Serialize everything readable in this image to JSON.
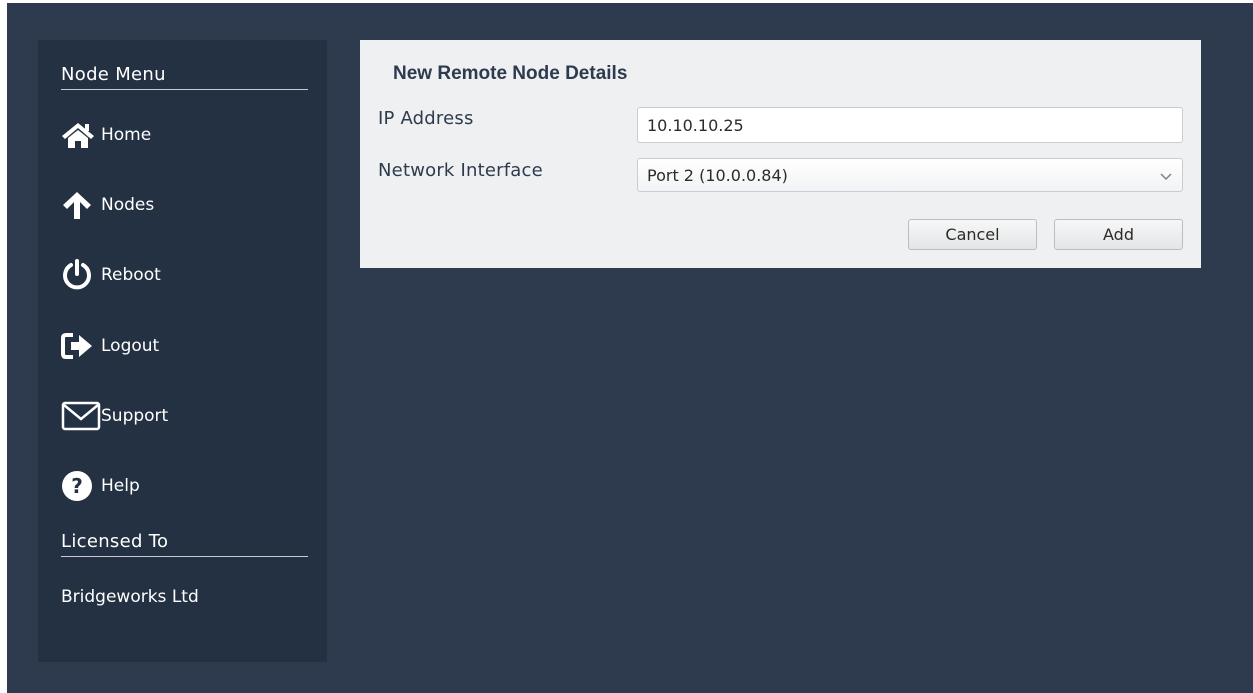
{
  "sidebar": {
    "node_menu_title": "Node Menu",
    "items": [
      {
        "label": "Home",
        "icon": "home-icon"
      },
      {
        "label": "Nodes",
        "icon": "arrow-up-icon"
      },
      {
        "label": "Reboot",
        "icon": "power-icon"
      },
      {
        "label": "Logout",
        "icon": "logout-icon"
      },
      {
        "label": "Support",
        "icon": "envelope-icon"
      },
      {
        "label": "Help",
        "icon": "question-icon"
      }
    ],
    "licensed_title": "Licensed To",
    "licensee": "Bridgeworks Ltd"
  },
  "panel": {
    "title": "New Remote Node Details",
    "ip_label": "IP Address",
    "ip_value": "10.10.10.25",
    "iface_label": "Network Interface",
    "iface_value": "Port 2 (10.0.0.84)",
    "cancel_label": "Cancel",
    "add_label": "Add"
  },
  "colors": {
    "background": "#2e3b4e",
    "sidebar": "#243142",
    "panel": "#eef0f1",
    "text_dark": "#2e3b4e"
  }
}
